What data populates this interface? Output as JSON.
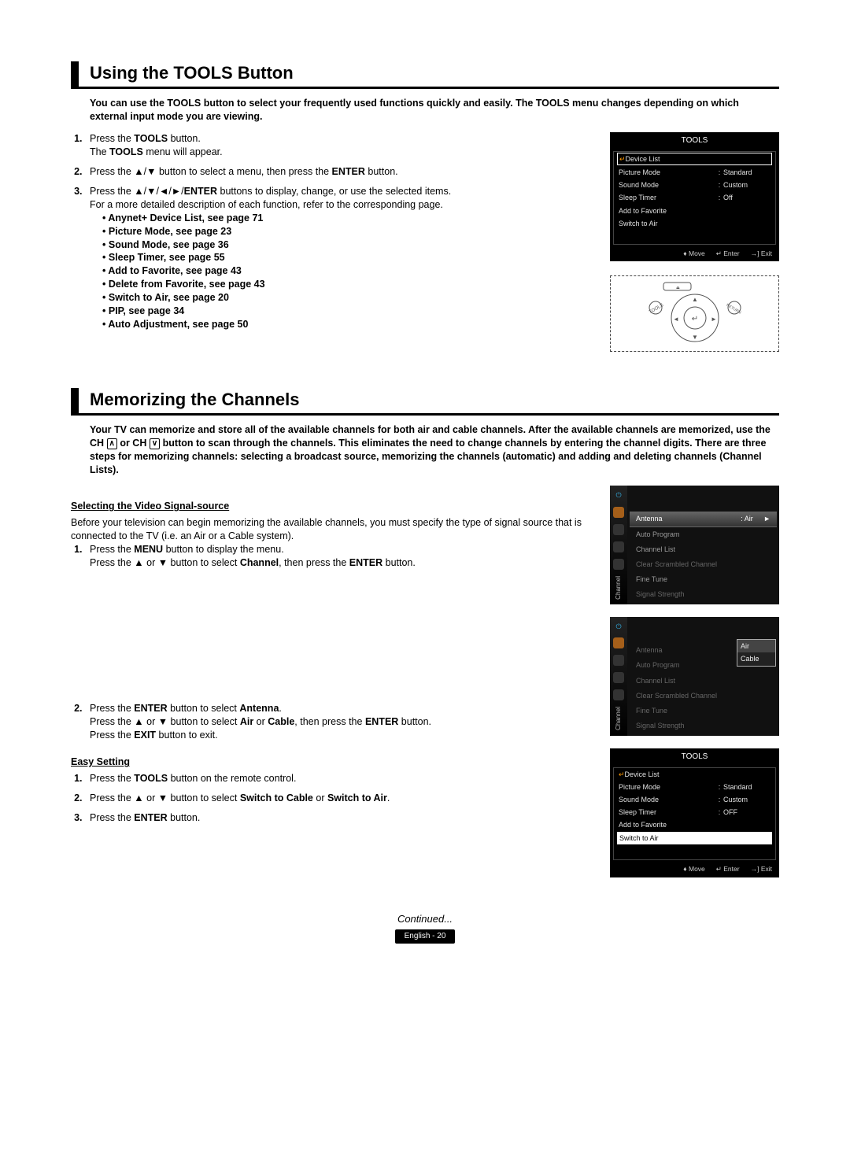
{
  "section1": {
    "title": "Using the TOOLS Button",
    "intro": "You can use the TOOLS button to select your frequently used functions quickly and easily. The TOOLS menu changes depending on which external input mode you are viewing.",
    "step1_a": "Press the ",
    "step1_b": "TOOLS",
    "step1_c": " button.",
    "step1_d": "The ",
    "step1_e": "TOOLS",
    "step1_f": " menu will appear.",
    "step2_a": "Press the ▲/▼ button to select a menu, then press the ",
    "step2_b": "ENTER",
    "step2_c": " button.",
    "step3_a": "Press the ▲/▼/◄/►/",
    "step3_b": "ENTER",
    "step3_c": " buttons to display, change, or use the selected items.",
    "step3_d": "For a more detailed description of each function, refer to the corresponding page.",
    "reflist": [
      "Anynet+ Device List, see page 71",
      "Picture Mode, see page 23",
      "Sound Mode, see page 36",
      "Sleep Timer, see page  55",
      "Add to Favorite, see page 43",
      "Delete from Favorite, see page 43",
      "Switch to Air, see page 20",
      "PIP, see page 34",
      "Auto Adjustment, see page 50"
    ]
  },
  "tools_osd1": {
    "title": "TOOLS",
    "hl": "Device List",
    "rows": [
      {
        "lbl": "Picture Mode",
        "val": "Standard"
      },
      {
        "lbl": "Sound Mode",
        "val": "Custom"
      },
      {
        "lbl": "Sleep Timer",
        "val": "Off"
      },
      {
        "lbl": "Add to Favorite",
        "val": ""
      },
      {
        "lbl": "Switch to Air",
        "val": ""
      }
    ],
    "foot": {
      "move": "Move",
      "enter": "Enter",
      "exit": "Exit"
    }
  },
  "section2": {
    "title": "Memorizing the Channels",
    "intro_a": "Your TV can memorize and store all of the available channels for both air and cable channels. After the available channels are memorized, use the CH ",
    "intro_up": "∧",
    "intro_b": " or CH ",
    "intro_dn": "∨",
    "intro_c": " button to scan through the channels. This eliminates the need to change channels by entering the channel digits. There are three steps for memorizing channels: selecting a broadcast source, memorizing the channels (automatic) and adding and deleting channels (Channel Lists).",
    "sub1": "Selecting the Video Signal-source",
    "sub1_text": "Before your television can begin memorizing the available channels, you must specify the type of signal source that is connected to the TV (i.e. an Air or a Cable system).",
    "s1_a": "Press the ",
    "s1_b": "MENU",
    "s1_c": " button to display the menu.",
    "s1_d": "Press the ▲ or ▼ button to select ",
    "s1_e": "Channel",
    "s1_f": ", then press the ",
    "s1_g": "ENTER",
    "s1_h": " button.",
    "s2_a": "Press the ",
    "s2_b": "ENTER",
    "s2_c": " button to select ",
    "s2_d": "Antenna",
    "s2_e": ".",
    "s2_f": "Press the ▲ or ▼ button to select ",
    "s2_g": "Air",
    "s2_h": " or ",
    "s2_i": "Cable",
    "s2_j": ", then press the ",
    "s2_k": "ENTER",
    "s2_l": " button.",
    "s2_m": "Press the ",
    "s2_n": "EXIT",
    "s2_o": " button to exit.",
    "sub2": "Easy Setting",
    "e1_a": "Press the ",
    "e1_b": "TOOLS",
    "e1_c": " button on the remote control.",
    "e2_a": "Press the ▲ or ▼ button to select ",
    "e2_b": "Switch to Cable",
    "e2_c": " or ",
    "e2_d": "Switch to Air",
    "e2_e": ".",
    "e3_a": "Press the ",
    "e3_b": "ENTER",
    "e3_c": " button."
  },
  "channel_osd": {
    "sidelabel": "Channel",
    "antenna": "Antenna",
    "antenna_val": ": Air",
    "items": [
      "Auto Program",
      "Channel List",
      "Clear Scrambled Channel",
      "Fine Tune",
      "Signal Strength"
    ],
    "popup": [
      "Air",
      "Cable"
    ]
  },
  "tools_osd2": {
    "title": "TOOLS",
    "hl_top": "Device List",
    "rows": [
      {
        "lbl": "Picture Mode",
        "val": "Standard"
      },
      {
        "lbl": "Sound Mode",
        "val": "Custom"
      },
      {
        "lbl": "Sleep Timer",
        "val": "OFF"
      },
      {
        "lbl": "Add to Favorite",
        "val": ""
      }
    ],
    "hl_bottom": "Switch to Air",
    "foot": {
      "move": "Move",
      "enter": "Enter",
      "exit": "Exit"
    }
  },
  "continued": "Continued...",
  "pagefoot": "English - 20"
}
